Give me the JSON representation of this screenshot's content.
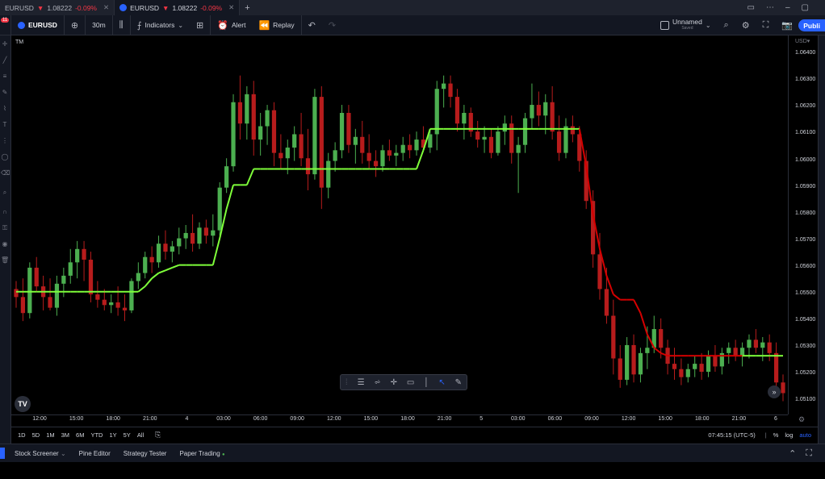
{
  "tabs": [
    {
      "symbol": "EURUSD",
      "arrow": "▼",
      "price": "1.08222",
      "change": "-0.09%"
    },
    {
      "symbol": "EURUSD",
      "arrow": "▼",
      "price": "1.08222",
      "change": "-0.09%"
    }
  ],
  "toolbar": {
    "notif_count": "11",
    "symbol": "EURUSD",
    "interval": "30m",
    "indicators": "Indicators",
    "alert": "Alert",
    "replay": "Replay",
    "layout_name": "Unnamed",
    "layout_status": "Saved",
    "publish": "Publi"
  },
  "chart": {
    "indicator_label": "TM",
    "currency": "USD",
    "colors": {
      "up": "#4caf50",
      "down": "#b71c1c",
      "line_up": "#7fff3a",
      "line_down": "#d50000",
      "bg": "#000000"
    }
  },
  "chart_data": {
    "type": "candlestick",
    "y_ticks": [
      "1.06400",
      "1.06300",
      "1.06200",
      "1.06100",
      "1.06000",
      "1.05900",
      "1.05800",
      "1.05700",
      "1.05600",
      "1.05500",
      "1.05400",
      "1.05300",
      "1.05200",
      "1.05100"
    ],
    "x_ticks": [
      "12:00",
      "15:00",
      "18:00",
      "21:00",
      "4",
      "03:00",
      "06:00",
      "09:00",
      "12:00",
      "15:00",
      "18:00",
      "21:00",
      "5",
      "03:00",
      "06:00",
      "09:00",
      "12:00",
      "15:00",
      "18:00",
      "21:00",
      "6"
    ],
    "ylim": [
      1.0505,
      1.0647
    ],
    "candles": [
      [
        1.0552,
        1.0555,
        1.0545,
        1.0549
      ],
      [
        1.0549,
        1.0556,
        1.054,
        1.0543
      ],
      [
        1.0543,
        1.0562,
        1.0541,
        1.056
      ],
      [
        1.056,
        1.0564,
        1.0551,
        1.0553
      ],
      [
        1.0553,
        1.0557,
        1.0544,
        1.0549
      ],
      [
        1.0549,
        1.0556,
        1.0544,
        1.0545
      ],
      [
        1.0545,
        1.0557,
        1.0542,
        1.0554
      ],
      [
        1.0554,
        1.056,
        1.0549,
        1.0557
      ],
      [
        1.0557,
        1.0567,
        1.0554,
        1.0562
      ],
      [
        1.0562,
        1.057,
        1.0556,
        1.0567
      ],
      [
        1.0567,
        1.057,
        1.0555,
        1.0563
      ],
      [
        1.0563,
        1.0566,
        1.0547,
        1.055
      ],
      [
        1.055,
        1.0555,
        1.0545,
        1.0548
      ],
      [
        1.0548,
        1.0552,
        1.0544,
        1.0546
      ],
      [
        1.0546,
        1.055,
        1.0543,
        1.0547
      ],
      [
        1.0547,
        1.0553,
        1.0542,
        1.0545
      ],
      [
        1.0545,
        1.055,
        1.054,
        1.0544
      ],
      [
        1.0544,
        1.0556,
        1.0543,
        1.0555
      ],
      [
        1.0555,
        1.0562,
        1.0552,
        1.0558
      ],
      [
        1.0558,
        1.0566,
        1.0556,
        1.0564
      ],
      [
        1.0564,
        1.0568,
        1.0558,
        1.0562
      ],
      [
        1.0562,
        1.0572,
        1.056,
        1.0569
      ],
      [
        1.0569,
        1.0574,
        1.0563,
        1.0566
      ],
      [
        1.0566,
        1.057,
        1.0562,
        1.0568
      ],
      [
        1.0568,
        1.0575,
        1.0565,
        1.0571
      ],
      [
        1.0571,
        1.0576,
        1.0567,
        1.0573
      ],
      [
        1.0573,
        1.058,
        1.0566,
        1.0569
      ],
      [
        1.0569,
        1.0577,
        1.0567,
        1.0575
      ],
      [
        1.0575,
        1.0578,
        1.0569,
        1.0572
      ],
      [
        1.0572,
        1.058,
        1.0568,
        1.0574
      ],
      [
        1.0574,
        1.0592,
        1.0572,
        1.059
      ],
      [
        1.059,
        1.0601,
        1.0588,
        1.0598
      ],
      [
        1.0598,
        1.0625,
        1.0596,
        1.0622
      ],
      [
        1.0622,
        1.0632,
        1.0608,
        1.0614
      ],
      [
        1.0614,
        1.0628,
        1.0608,
        1.0625
      ],
      [
        1.0625,
        1.063,
        1.0602,
        1.0608
      ],
      [
        1.0608,
        1.0618,
        1.0602,
        1.0613
      ],
      [
        1.0613,
        1.0621,
        1.0606,
        1.0619
      ],
      [
        1.0619,
        1.0622,
        1.0598,
        1.0603
      ],
      [
        1.0603,
        1.061,
        1.0597,
        1.0601
      ],
      [
        1.0601,
        1.0608,
        1.0595,
        1.0605
      ],
      [
        1.0605,
        1.0613,
        1.06,
        1.061
      ],
      [
        1.061,
        1.0618,
        1.0598,
        1.0601
      ],
      [
        1.0601,
        1.0612,
        1.0589,
        1.0595
      ],
      [
        1.0595,
        1.0627,
        1.0593,
        1.0624
      ],
      [
        1.0624,
        1.0628,
        1.0582,
        1.059
      ],
      [
        1.059,
        1.0603,
        1.0586,
        1.06
      ],
      [
        1.06,
        1.0607,
        1.0596,
        1.0604
      ],
      [
        1.0604,
        1.0621,
        1.0601,
        1.0618
      ],
      [
        1.0618,
        1.0621,
        1.0603,
        1.0606
      ],
      [
        1.0606,
        1.0612,
        1.0599,
        1.0609
      ],
      [
        1.0609,
        1.0615,
        1.0599,
        1.0603
      ],
      [
        1.0603,
        1.061,
        1.0597,
        1.06
      ],
      [
        1.06,
        1.0604,
        1.0594,
        1.0598
      ],
      [
        1.0598,
        1.0606,
        1.0596,
        1.0604
      ],
      [
        1.0604,
        1.0608,
        1.06,
        1.0602
      ],
      [
        1.0602,
        1.0606,
        1.0598,
        1.0603
      ],
      [
        1.0603,
        1.0609,
        1.06,
        1.0606
      ],
      [
        1.0606,
        1.061,
        1.0601,
        1.0604
      ],
      [
        1.0604,
        1.0611,
        1.0602,
        1.0608
      ],
      [
        1.0608,
        1.0613,
        1.0604,
        1.0605
      ],
      [
        1.0605,
        1.0612,
        1.0603,
        1.061
      ],
      [
        1.061,
        1.063,
        1.0604,
        1.0627
      ],
      [
        1.0627,
        1.0632,
        1.062,
        1.0629
      ],
      [
        1.0629,
        1.0632,
        1.062,
        1.0624
      ],
      [
        1.0624,
        1.0627,
        1.0611,
        1.0614
      ],
      [
        1.0614,
        1.0621,
        1.0608,
        1.0618
      ],
      [
        1.0618,
        1.062,
        1.0609,
        1.0611
      ],
      [
        1.0611,
        1.0615,
        1.0605,
        1.0608
      ],
      [
        1.0608,
        1.0613,
        1.0603,
        1.0609
      ],
      [
        1.0609,
        1.0612,
        1.0601,
        1.0603
      ],
      [
        1.0603,
        1.0613,
        1.0602,
        1.0611
      ],
      [
        1.0611,
        1.0617,
        1.0606,
        1.0614
      ],
      [
        1.0614,
        1.0617,
        1.0599,
        1.0603
      ],
      [
        1.0603,
        1.0609,
        1.0588,
        1.0606
      ],
      [
        1.0606,
        1.0618,
        1.0603,
        1.0616
      ],
      [
        1.0616,
        1.0629,
        1.0612,
        1.0621
      ],
      [
        1.0621,
        1.0626,
        1.0613,
        1.0617
      ],
      [
        1.0617,
        1.0625,
        1.061,
        1.0622
      ],
      [
        1.0622,
        1.0628,
        1.0608,
        1.0611
      ],
      [
        1.0611,
        1.0617,
        1.06,
        1.0603
      ],
      [
        1.0603,
        1.0616,
        1.0601,
        1.0613
      ],
      [
        1.0613,
        1.0617,
        1.0607,
        1.061
      ],
      [
        1.061,
        1.0613,
        1.0596,
        1.06
      ],
      [
        1.06,
        1.0604,
        1.0582,
        1.0585
      ],
      [
        1.0585,
        1.0589,
        1.056,
        1.0565
      ],
      [
        1.0565,
        1.0573,
        1.0548,
        1.0552
      ],
      [
        1.0552,
        1.056,
        1.0539,
        1.0542
      ],
      [
        1.0542,
        1.0548,
        1.052,
        1.0526
      ],
      [
        1.0526,
        1.0531,
        1.0515,
        1.0518
      ],
      [
        1.0518,
        1.0534,
        1.0516,
        1.0531
      ],
      [
        1.0531,
        1.0535,
        1.0517,
        1.052
      ],
      [
        1.052,
        1.053,
        1.0517,
        1.0528
      ],
      [
        1.0528,
        1.0538,
        1.0522,
        1.053
      ],
      [
        1.053,
        1.0542,
        1.0528,
        1.0537
      ],
      [
        1.0537,
        1.0541,
        1.0526,
        1.053
      ],
      [
        1.053,
        1.0533,
        1.052,
        1.0524
      ],
      [
        1.0524,
        1.053,
        1.0518,
        1.0522
      ],
      [
        1.0522,
        1.0526,
        1.0516,
        1.0519
      ],
      [
        1.0519,
        1.0524,
        1.0517,
        1.0522
      ],
      [
        1.0522,
        1.0527,
        1.0519,
        1.0524
      ],
      [
        1.0524,
        1.0528,
        1.0518,
        1.0521
      ],
      [
        1.0521,
        1.0529,
        1.0519,
        1.0527
      ],
      [
        1.0527,
        1.0531,
        1.0521,
        1.0523
      ],
      [
        1.0523,
        1.053,
        1.052,
        1.0528
      ],
      [
        1.0528,
        1.0532,
        1.0524,
        1.053
      ],
      [
        1.053,
        1.0533,
        1.0525,
        1.0527
      ],
      [
        1.0527,
        1.0532,
        1.0523,
        1.053
      ],
      [
        1.053,
        1.0535,
        1.0526,
        1.0533
      ],
      [
        1.0533,
        1.0537,
        1.0528,
        1.053
      ],
      [
        1.053,
        1.0534,
        1.0525,
        1.0532
      ],
      [
        1.0532,
        1.0535,
        1.0525,
        1.0528
      ],
      [
        1.0528,
        1.0532,
        1.0512,
        1.0517
      ],
      [
        1.0517,
        1.052,
        1.051,
        1.0513
      ]
    ],
    "trail": [
      1.0551,
      1.0551,
      1.0551,
      1.0551,
      1.0551,
      1.0551,
      1.0551,
      1.0551,
      1.0551,
      1.0551,
      1.0551,
      1.0551,
      1.0551,
      1.0551,
      1.0551,
      1.0551,
      1.0551,
      1.0551,
      1.0551,
      1.0553,
      1.0556,
      1.0558,
      1.0559,
      1.056,
      1.0561,
      1.0561,
      1.0561,
      1.0561,
      1.0561,
      1.0561,
      1.0571,
      1.0582,
      1.0591,
      1.0591,
      1.0591,
      1.0597,
      1.0597,
      1.0597,
      1.0597,
      1.0597,
      1.0597,
      1.0597,
      1.0597,
      1.0597,
      1.0597,
      1.0597,
      1.0597,
      1.0597,
      1.0597,
      1.0597,
      1.0597,
      1.0597,
      1.0597,
      1.0597,
      1.0597,
      1.0597,
      1.0597,
      1.0597,
      1.0597,
      1.0597,
      1.0604,
      1.0612,
      1.0612,
      1.0612,
      1.0612,
      1.0612,
      1.0612,
      1.0612,
      1.0612,
      1.0612,
      1.0612,
      1.0612,
      1.0612,
      1.0612,
      1.0612,
      1.0612,
      1.0612,
      1.0612,
      1.0612,
      1.0612,
      1.0612,
      1.0612,
      1.0612,
      1.0612,
      1.0598,
      1.058,
      1.0567,
      1.0557,
      1.055,
      1.0548,
      1.0548,
      1.0548,
      1.0543,
      1.0535,
      1.053,
      1.0528,
      1.0527,
      1.0527,
      1.0527,
      1.0527,
      1.0527,
      1.0527,
      1.0527,
      1.0527,
      1.0527,
      1.0527,
      1.0527,
      1.0527,
      1.0527,
      1.0527,
      1.0527,
      1.0527,
      1.0527,
      1.0527
    ],
    "trail_direction": "up-green / down-red"
  },
  "timeframes": [
    "1D",
    "5D",
    "1M",
    "3M",
    "6M",
    "YTD",
    "1Y",
    "5Y",
    "All"
  ],
  "status": {
    "time": "07:45:15 (UTC-5)",
    "pct": "%",
    "log": "log",
    "auto": "auto"
  },
  "bottom_tabs": [
    "Stock Screener",
    "Pine Editor",
    "Strategy Tester",
    "Paper Trading"
  ]
}
